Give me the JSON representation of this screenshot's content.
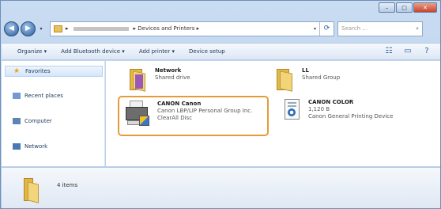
{
  "window": {
    "minimize": "–",
    "maximize": "□",
    "close": "✕"
  },
  "nav": {
    "back_icon": "arrow-left-icon",
    "forward_icon": "arrow-right-icon",
    "address_segments": [
      "▸",
      "▸ Devices and Printers ▸"
    ],
    "search_placeholder": "Search ..."
  },
  "toolbar": {
    "items": [
      "Organize ▾",
      "Add Bluetooth device ▾",
      "Add printer ▾",
      "Device setup"
    ]
  },
  "sidebar": {
    "items": [
      "Favorites",
      "Recent places",
      "Computer",
      "Network"
    ]
  },
  "content": {
    "tiles": [
      {
        "name": "Network",
        "sub": "Shared drive"
      },
      {
        "name": "LL",
        "sub": "Shared Group"
      },
      {
        "name": "CANON Canon",
        "sub": "Canon LBP/LIP Personal Group Inc.",
        "sub2": "ClearAll Disc"
      },
      {
        "name": "CANON COLOR",
        "sub": "1,120 B",
        "sub2": "Canon General Printing Device"
      }
    ]
  },
  "details": {
    "text": "4 items"
  }
}
